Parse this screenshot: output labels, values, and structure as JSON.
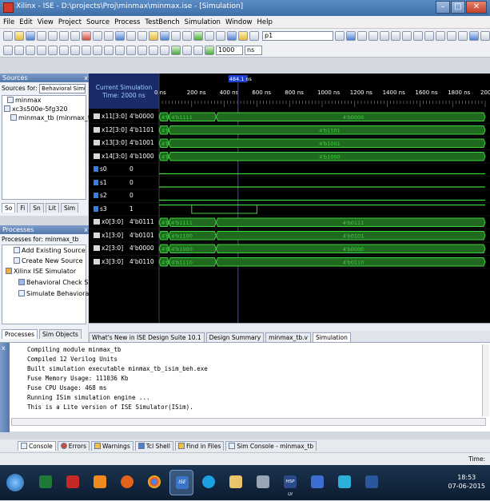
{
  "window": {
    "title": "Xilinx - ISE - D:\\projects\\Proj\\minmax\\minmax.ise - [Simulation]"
  },
  "menubar": [
    "File",
    "Edit",
    "View",
    "Project",
    "Source",
    "Process",
    "TestBench",
    "Simulation",
    "Window",
    "Help"
  ],
  "toolbar": {
    "search_value": "p1",
    "runtime_value": "1000",
    "runtime_unit": "ns"
  },
  "sources": {
    "header": "Sources",
    "for_label": "Sources for:",
    "for_value": "Behavioral Simulation",
    "items": [
      "minmax",
      "xc3s500e-5fg320",
      "minmax_tb (minmax_tb.v)"
    ]
  },
  "sources_tabs": [
    "So",
    "Fi",
    "Sn",
    "Lit",
    "Sim"
  ],
  "processes": {
    "header": "Processes",
    "for_label": "Processes for: minmax_tb",
    "items": [
      "Add Existing Source",
      "Create New Source",
      "Xilinx ISE Simulator",
      "Behavioral Check Syntax",
      "Simulate Behavioral Model"
    ]
  },
  "processes_tabs": [
    "Processes",
    "Sim Objects"
  ],
  "wave": {
    "header_title": "Current Simulation",
    "header_time": "Time: 2000 ns",
    "cursor_label": "484.1 ns",
    "timescale": [
      "0 ns",
      "200 ns",
      "400 ns",
      "600 ns",
      "800 ns",
      "1000 ns",
      "1200 ns",
      "1400 ns",
      "1600 ns",
      "1800 ns",
      "2000 ns"
    ],
    "signals": [
      {
        "name": "x11[3:0]",
        "value": "4'b0000",
        "kind": "bus",
        "seg1": "4'b0000",
        "seg2": "4'b1111",
        "seg3": "4'b0000"
      },
      {
        "name": "x12[3:0]",
        "value": "4'b1101",
        "kind": "bus",
        "seg1": "4'b0000",
        "seg2": "",
        "seg3": "4'b1101"
      },
      {
        "name": "x13[3:0]",
        "value": "4'b1001",
        "kind": "bus",
        "seg1": "4'b0000",
        "seg2": "",
        "seg3": "4'b1001"
      },
      {
        "name": "x14[3:0]",
        "value": "4'b1000",
        "kind": "bus",
        "seg1": "4'b0000",
        "seg2": "",
        "seg3": "4'b1000"
      },
      {
        "name": "s0",
        "value": "0",
        "kind": "bit",
        "level": 0
      },
      {
        "name": "s1",
        "value": "0",
        "kind": "bit",
        "level": 0
      },
      {
        "name": "s2",
        "value": "0",
        "kind": "bit",
        "level": 0
      },
      {
        "name": "s3",
        "value": "1",
        "kind": "bit",
        "level": 1
      },
      {
        "name": "x0[3:0]",
        "value": "4'b0111",
        "kind": "bus",
        "seg1": "4'b0000",
        "seg2": "4'b1111",
        "seg3": "4'b0111"
      },
      {
        "name": "x1[3:0]",
        "value": "4'b0101",
        "kind": "bus",
        "seg1": "4'b0000",
        "seg2": "4'b1100",
        "seg3": "4'b0101"
      },
      {
        "name": "x2[3:0]",
        "value": "4'b0000",
        "kind": "bus",
        "seg1": "4'b0000",
        "seg2": "4'b1000",
        "seg3": "4'b0000"
      },
      {
        "name": "x3[3:0]",
        "value": "4'b0110",
        "kind": "bus",
        "seg1": "4'b0000",
        "seg2": "4'b1110",
        "seg3": "4'b0110"
      }
    ]
  },
  "editor_tabs": [
    "What's New in ISE Design Suite 10.1",
    "Design Summary",
    "minmax_tb.v",
    "Simulation"
  ],
  "console": {
    "lines": [
      "Compiling module minmax_tb",
      "Compiled 12 Verilog Units",
      "Built simulation executable minmax_tb_isim_beh.exe",
      "Fuse Memory Usage: 111036 Kb",
      "Fuse CPU Usage: 468 ms",
      "Running ISim simulation engine ...",
      "This is a Lite version of ISE Simulator(ISim)."
    ]
  },
  "bottom_tabs": [
    "Console",
    "Errors",
    "Warnings",
    "Tcl Shell",
    "Find in Files",
    "Sim Console - minmax_tb"
  ],
  "statusbar": {
    "time_label": "Time:"
  },
  "taskbar": {
    "time": "18:53",
    "date": "07-06-2015",
    "apps": [
      "ISE",
      "HSP UI"
    ]
  },
  "colors": {
    "wave_bg": "#000000",
    "wave_green": "#3fd23f",
    "bus_fill": "#1f6a1f",
    "title_blue": "#4a7ab8"
  }
}
